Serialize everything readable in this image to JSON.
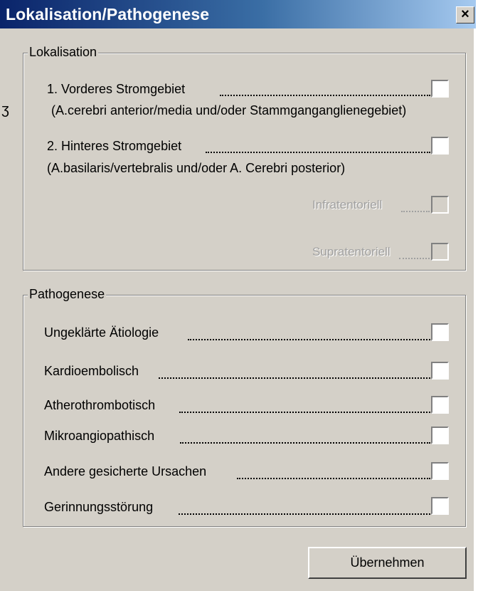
{
  "window": {
    "title": "Lokalisation/Pathogenese",
    "close_glyph": "×"
  },
  "lokalisation": {
    "legend": "Lokalisation",
    "items": [
      {
        "label": "1. Vorderes Stromgebiet",
        "sub": "(A.cerebri anterior/media und/oder Stammganganglienegebiet)"
      },
      {
        "label": "2. Hinteres Stromgebiet",
        "sub": "(A.basilaris/vertebralis und/oder A. Cerebri posterior)"
      }
    ],
    "sub_options": [
      {
        "label": "Infratentoriell",
        "enabled": false
      },
      {
        "label": "Supratentoriell",
        "enabled": false
      }
    ]
  },
  "pathogenese": {
    "legend": "Pathogenese",
    "items": [
      {
        "label": "Ungeklärte Ätiologie"
      },
      {
        "label": "Kardioembolisch"
      },
      {
        "label": "Atherothrombotisch"
      },
      {
        "label": "Mikroangiopathisch"
      },
      {
        "label": "Andere gesicherte Ursachen"
      },
      {
        "label": "Gerinnungsstörung"
      }
    ]
  },
  "buttons": {
    "apply": "Übernehmen"
  }
}
